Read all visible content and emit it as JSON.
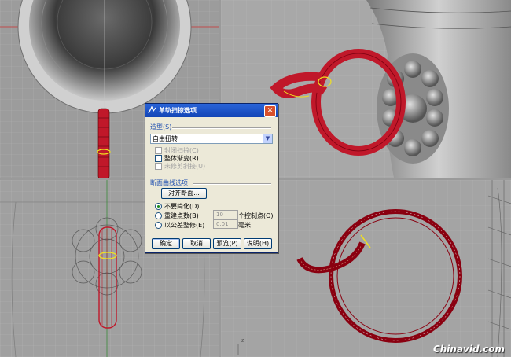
{
  "dialog": {
    "title": "单轨扫掠选项",
    "section_style_label": "造型(S)",
    "style_value": "自由扭转",
    "checkboxes": [
      {
        "label": "封闭扫掠(C)",
        "checked": false,
        "enabled": false
      },
      {
        "label": "整体渐变(R)",
        "checked": false,
        "enabled": true
      },
      {
        "label": "未修剪斜接(U)",
        "checked": false,
        "enabled": false
      }
    ],
    "section_curve_label": "断面曲线选项",
    "align_button": "对齐断面...",
    "radios": [
      {
        "label": "不要简化(D)",
        "selected": true
      },
      {
        "label": "重建点数(B)",
        "selected": false
      },
      {
        "label": "以公差整修(E)",
        "selected": false
      }
    ],
    "rebuild_points_value": "10",
    "rebuild_points_unit": "个控制点(O)",
    "tolerance_value": "0.01",
    "tolerance_unit": "毫米",
    "buttons": {
      "ok": "确定",
      "cancel": "取消",
      "preview": "预览(P)",
      "help": "说明(H)"
    }
  },
  "watermark": "Chinavid.com",
  "colors": {
    "viewport_bg": "#9c9c9c",
    "grid_line": "#b0b0b0",
    "rail_red": "#c0182a",
    "curve_yellow": "#f0e020",
    "title_blue": "#1a52c8"
  }
}
